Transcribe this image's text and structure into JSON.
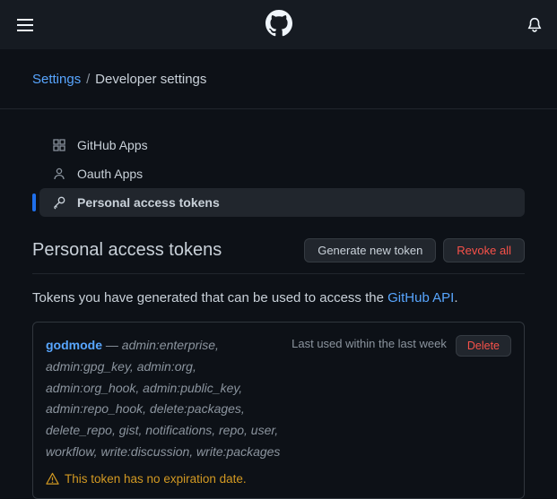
{
  "breadcrumb": {
    "parent": "Settings",
    "current": "Developer settings"
  },
  "sidenav": {
    "items": [
      {
        "label": "GitHub Apps"
      },
      {
        "label": "Oauth Apps"
      },
      {
        "label": "Personal access tokens"
      }
    ]
  },
  "heading": "Personal access tokens",
  "buttons": {
    "generate": "Generate new token",
    "revoke": "Revoke all",
    "delete": "Delete"
  },
  "lead": {
    "text_before": "Tokens you have generated that can be used to access the ",
    "link": "GitHub API",
    "text_after": "."
  },
  "token": {
    "name": "godmode",
    "dash": " — ",
    "scopes": "admin:enterprise, admin:gpg_key, admin:org, admin:org_hook, admin:public_key, admin:repo_hook, delete:packages, delete_repo, gist, notifications, repo, user, workflow, write:discussion, write:packages",
    "last_used": "Last used within the last week",
    "warning": "This token has no expiration date."
  }
}
